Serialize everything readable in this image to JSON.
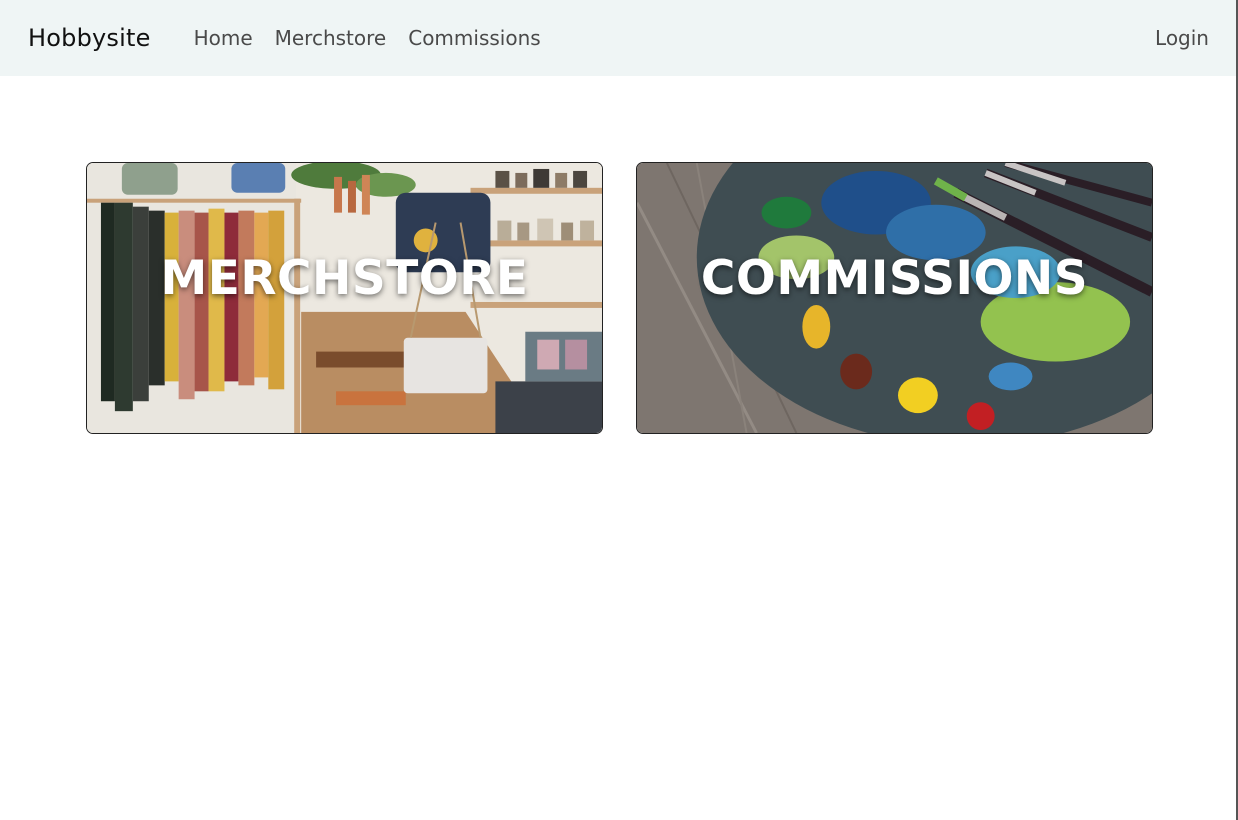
{
  "navbar": {
    "brand": "Hobbysite",
    "links": [
      {
        "label": "Home"
      },
      {
        "label": "Merchstore"
      },
      {
        "label": "Commissions"
      }
    ],
    "login_label": "Login"
  },
  "cards": [
    {
      "title": "MERCHSTORE",
      "image": "clothing-store-photo"
    },
    {
      "title": "COMMISSIONS",
      "image": "paint-palette-photo"
    }
  ],
  "colors": {
    "navbar_bg": "#eff5f5",
    "nav_text": "#4a4a4a",
    "brand_text": "#111111",
    "card_title": "#ffffff"
  }
}
